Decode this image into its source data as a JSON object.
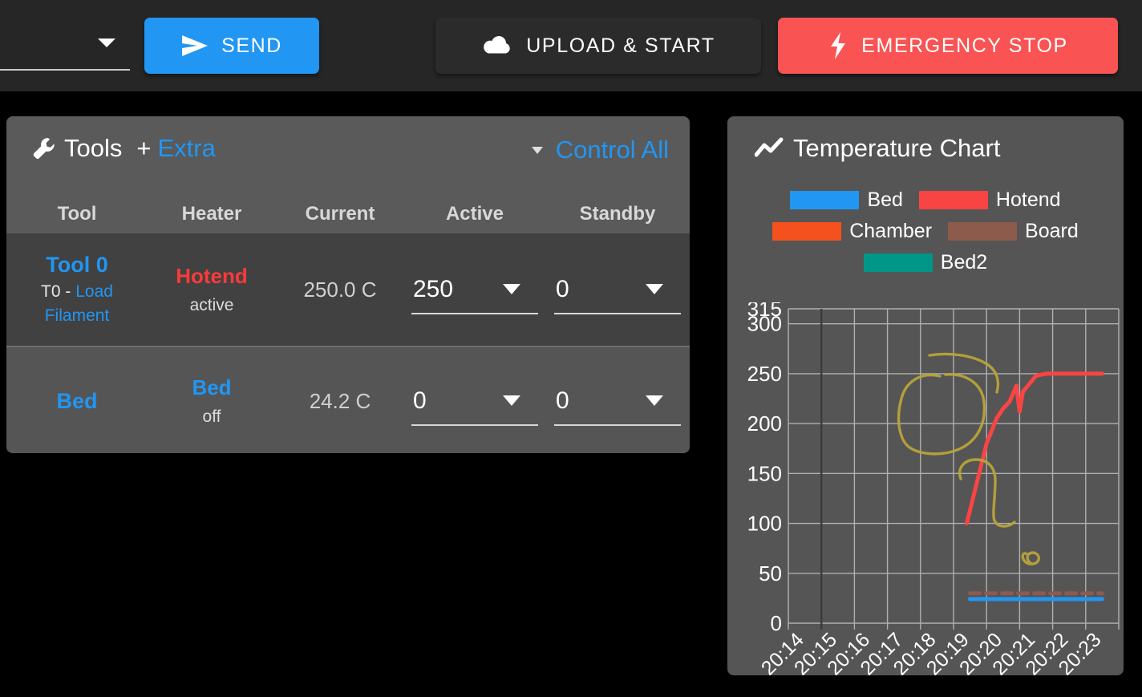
{
  "topbar": {
    "macro_select": {
      "value": "",
      "caret_icon": "chevron-down-icon"
    },
    "send_button": {
      "label": "SEND",
      "icon": "send-icon",
      "color": "#2196f3"
    },
    "upload_button": {
      "label": "UPLOAD & START",
      "icon": "cloud-upload-icon",
      "color": "#2b2b2b"
    },
    "emergency_button": {
      "label": "EMERGENCY STOP",
      "icon": "lightning-bolt-icon",
      "color": "#f95353"
    }
  },
  "tools_panel": {
    "title": "Tools",
    "title_icon": "wrench-icon",
    "plus": "+",
    "extra_label": "Extra",
    "control_all_label": "Control All",
    "control_all_caret": "chevron-down-icon",
    "columns": [
      "Tool",
      "Heater",
      "Current",
      "Active",
      "Standby"
    ],
    "rows": [
      {
        "tool_name": "Tool 0",
        "tool_sub_prefix": "T0 - ",
        "tool_sub_link": "Load Filament",
        "heater_name": "Hotend",
        "heater_color": "#fb3a3a",
        "heater_state": "active",
        "current": "250.0 C",
        "active": "250",
        "standby": "0"
      },
      {
        "tool_name": "Bed",
        "tool_sub_prefix": "",
        "tool_sub_link": "",
        "heater_name": "Bed",
        "heater_color": "#2196f3",
        "heater_state": "off",
        "current": "24.2 C",
        "active": "0",
        "standby": "0"
      }
    ]
  },
  "chart_panel": {
    "title": "Temperature Chart",
    "title_icon": "sparkline-icon"
  },
  "chart_data": {
    "type": "line",
    "title": "Temperature Chart",
    "xlabel": "",
    "ylabel": "",
    "grid": true,
    "legend_position": "top",
    "ylim": [
      0,
      315
    ],
    "yticks": [
      0,
      50,
      100,
      150,
      200,
      250,
      300,
      315
    ],
    "ytick_labels": [
      "0",
      "50",
      "100",
      "150",
      "200",
      "250",
      "300",
      "315"
    ],
    "x": [
      "20:14",
      "20:15",
      "20:16",
      "20:17",
      "20:18",
      "20:19",
      "20:20",
      "20:21",
      "20:22",
      "20:23"
    ],
    "series": [
      {
        "name": "Bed",
        "color": "#2196f3",
        "style": "solid",
        "x": [
          "20:19",
          "20:20",
          "20:21",
          "20:22",
          "20:23"
        ],
        "values": [
          24.2,
          24.2,
          24.2,
          24.2,
          24.2
        ]
      },
      {
        "name": "Hotend",
        "color": "#f94444",
        "style": "solid",
        "x": [
          "20:18.9",
          "20:19.2",
          "20:19.5",
          "20:19.8",
          "20:20.0",
          "20:20.2",
          "20:20.4",
          "20:20.5",
          "20:20.6",
          "20:20.8",
          "20:21.0",
          "20:21.3",
          "20:22.0",
          "20:23.0"
        ],
        "values": [
          100,
          140,
          180,
          205,
          215,
          222,
          238,
          212,
          232,
          240,
          248,
          250,
          250,
          250
        ]
      },
      {
        "name": "Chamber",
        "color": "#f4511e",
        "style": "solid",
        "x": [],
        "values": []
      },
      {
        "name": "Board",
        "color": "#8d5b4c",
        "style": "dashed",
        "x": [
          "20:19",
          "20:20",
          "20:21",
          "20:22",
          "20:23"
        ],
        "values": [
          30,
          30,
          30,
          30,
          30
        ]
      },
      {
        "name": "Bed2",
        "color": "#009688",
        "style": "solid",
        "x": [],
        "values": []
      }
    ],
    "annotations": [
      {
        "name": "hotend-peak-circle",
        "shape": "freehand-oval",
        "color": "#b8a33a"
      },
      {
        "name": "hook-squiggle",
        "shape": "freehand-hook",
        "color": "#b8a33a"
      },
      {
        "name": "small-circle-scribble",
        "shape": "freehand-circle",
        "color": "#b8a33a"
      }
    ]
  }
}
